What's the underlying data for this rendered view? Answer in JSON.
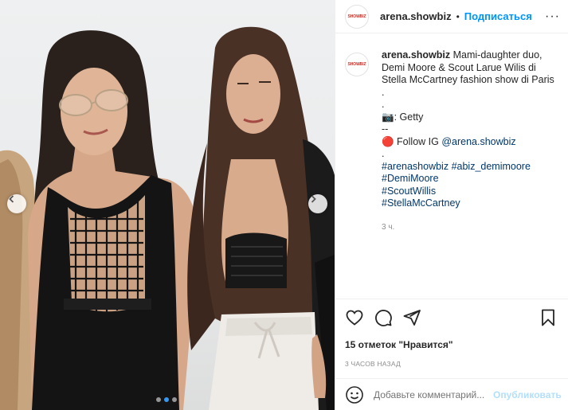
{
  "post": {
    "image_alt": "",
    "carousel": {
      "total": 3,
      "active": 1
    },
    "icons": {
      "prev": "chevron-left-icon",
      "next": "chevron-right-icon"
    }
  },
  "header": {
    "avatar_text": "SHOWBIZ",
    "username": "arena.showbiz",
    "separator": "•",
    "follow_label": "Подписаться",
    "more_label": "···"
  },
  "caption": {
    "username": "arena.showbiz",
    "text": "Mami-daughter duo, Demi Moore & Scout Larue Wilis di Stella McCartney fashion show di Paris",
    "dot1": ".",
    "dot2": ".",
    "credit_emoji": "📷",
    "credit_text": ": Getty",
    "dash": "--",
    "follow_emoji": "🔴",
    "follow_text": " Follow IG ",
    "follow_handle": "@arena.showbiz",
    "dot3": ".",
    "hashtags": [
      "#arenashowbiz",
      "#abiz_demimoore",
      "#DemiMoore",
      "#ScoutWillis",
      "#StellaMcCartney"
    ],
    "time": "3 ч."
  },
  "actions": {
    "icons": [
      "heart-icon",
      "comment-icon",
      "share-icon",
      "bookmark-icon"
    ],
    "likes": "15 отметок \"Нравится\"",
    "posted": "3 ЧАСОВ НАЗАД"
  },
  "comment": {
    "placeholder": "Добавьте комментарий...",
    "post_label": "Опубликовать"
  },
  "colors": {
    "link": "#00376b",
    "follow": "#0095f6",
    "active_dot": "#3897f0",
    "muted": "#8e8e8e"
  }
}
